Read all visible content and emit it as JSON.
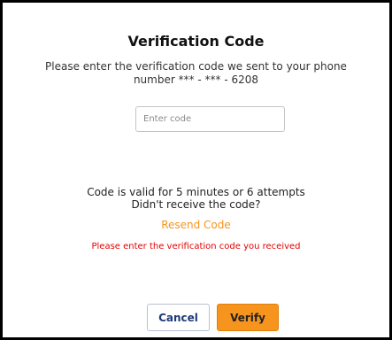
{
  "dialog": {
    "title": "Verification Code",
    "subtitle": "Please enter the verification code we sent to your phone number *** - *** - 6208",
    "code_input": {
      "value": "",
      "placeholder": "Enter code"
    },
    "validity_line1": "Code is valid for 5 minutes or 6 attempts",
    "validity_line2": "Didn't receive the code?",
    "resend_label": "Resend Code",
    "error_message": "Please enter the verification code you received",
    "cancel_label": "Cancel",
    "verify_label": "Verify"
  },
  "colors": {
    "accent": "#f7941d",
    "error": "#e30000",
    "cancel_text": "#1f3a77"
  }
}
